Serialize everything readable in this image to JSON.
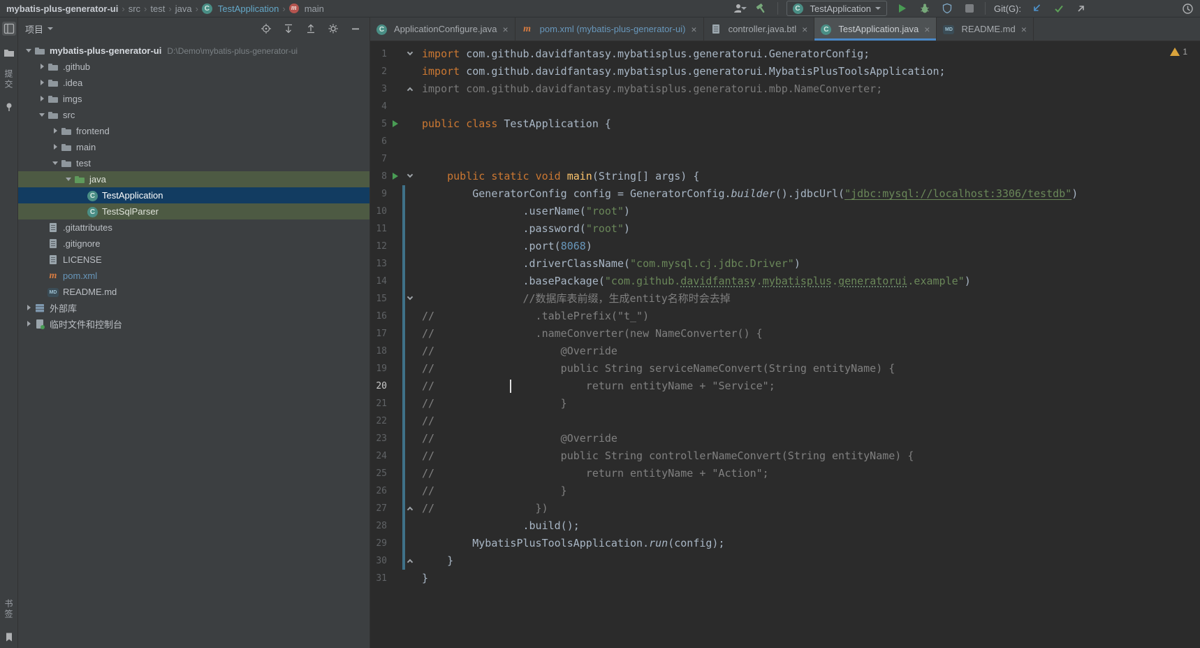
{
  "colors": {
    "accent_underline": "#4A88C7",
    "run_green": "#499C54",
    "selection_blue": "#123C61",
    "selection_green": "#4D5A43",
    "keyword_orange": "#CC7832",
    "string_green": "#6A8759",
    "number_blue": "#6897BB",
    "comment_gray": "#808080",
    "vcs_changed": "#3F7188"
  },
  "title_bar": {
    "breadcrumbs": [
      {
        "label": "mybatis-plus-generator-ui",
        "bold": true
      },
      {
        "label": "src"
      },
      {
        "label": "test"
      },
      {
        "label": "java"
      },
      {
        "label": "TestApplication",
        "icon": "class",
        "fg": "#64A8C8"
      },
      {
        "label": "main",
        "icon": "method"
      }
    ],
    "run_config": "TestApplication",
    "git_label": "Git(G):",
    "icons": [
      "user",
      "build",
      "run",
      "debug",
      "coverage",
      "stop",
      "update",
      "commit",
      "push",
      "history"
    ]
  },
  "left_toolbar": {
    "commit_label": "提交",
    "bookmarks_label": "书签"
  },
  "project_panel": {
    "title": "项目",
    "header_icons": [
      "locate",
      "expand-all",
      "collapse-all",
      "settings",
      "hide"
    ],
    "tree": [
      {
        "d": 0,
        "chev": "down",
        "icon": "root",
        "label": "mybatis-plus-generator-ui",
        "extra": "D:\\Demo\\mybatis-plus-generator-ui",
        "bold": true,
        "fg": "#D5D9DE"
      },
      {
        "d": 1,
        "chev": "right",
        "icon": "folder",
        "label": ".github"
      },
      {
        "d": 1,
        "chev": "right",
        "icon": "folder",
        "label": ".idea"
      },
      {
        "d": 1,
        "chev": "right",
        "icon": "folder",
        "label": "imgs"
      },
      {
        "d": 1,
        "chev": "down",
        "icon": "folder",
        "label": "src"
      },
      {
        "d": 2,
        "chev": "right",
        "icon": "folder",
        "label": "frontend"
      },
      {
        "d": 2,
        "chev": "right",
        "icon": "folder",
        "label": "main"
      },
      {
        "d": 2,
        "chev": "down",
        "icon": "folder",
        "label": "test"
      },
      {
        "d": 3,
        "chev": "down",
        "icon": "folder-test",
        "label": "java",
        "hl": "green",
        "fg": "#DFE3DA"
      },
      {
        "d": 4,
        "icon": "class",
        "label": "TestApplication",
        "hl": "blue",
        "fg": "#FFFFFF"
      },
      {
        "d": 4,
        "icon": "class",
        "label": "TestSqlParser",
        "hl": "green",
        "fg": "#DFE3DA"
      },
      {
        "d": 1,
        "icon": "file",
        "label": ".gitattributes"
      },
      {
        "d": 1,
        "icon": "file-gear",
        "label": ".gitignore"
      },
      {
        "d": 1,
        "icon": "file",
        "label": "LICENSE"
      },
      {
        "d": 1,
        "icon": "maven",
        "label": "pom.xml",
        "fg": "#6897BB"
      },
      {
        "d": 1,
        "icon": "markdown",
        "label": "README.md"
      },
      {
        "d": 0,
        "chev": "right",
        "icon": "library",
        "label": "外部库"
      },
      {
        "d": 0,
        "chev": "right",
        "icon": "scratch",
        "label": "临时文件和控制台"
      }
    ]
  },
  "editor": {
    "tabs": [
      {
        "label": "ApplicationConfigure.java",
        "icon": "class"
      },
      {
        "label": "pom.xml (mybatis-plus-generator-ui)",
        "icon": "maven",
        "fg": "#6897BB"
      },
      {
        "label": "controller.java.btl",
        "icon": "file"
      },
      {
        "label": "TestApplication.java",
        "icon": "class",
        "active": true
      },
      {
        "label": "README.md",
        "icon": "markdown"
      }
    ],
    "warnings": "1",
    "caret": {
      "line": 20,
      "col": 14
    },
    "code": {
      "current_line": 20,
      "run_lines": [
        5,
        8
      ],
      "changed_lines": [
        9,
        30
      ],
      "folds": {
        "1": "down",
        "3": "up",
        "8": "down",
        "15": "down",
        "27": "up",
        "30": "up"
      },
      "lines": [
        {
          "n": 1,
          "t": [
            [
              "k",
              "import"
            ],
            [
              "p",
              " com.github.davidfantasy.mybatisplus.generatorui.GeneratorConfig;"
            ]
          ]
        },
        {
          "n": 2,
          "t": [
            [
              "k",
              "import"
            ],
            [
              "p",
              " com.github.davidfantasy.mybatisplus.generatorui.MybatisPlusToolsApplication;"
            ]
          ]
        },
        {
          "n": 3,
          "t": [
            [
              "g",
              "import com.github.davidfantasy.mybatisplus.generatorui.mbp.NameConverter;"
            ]
          ]
        },
        {
          "n": 4,
          "t": []
        },
        {
          "n": 5,
          "t": [
            [
              "k",
              "public"
            ],
            [
              "p",
              " "
            ],
            [
              "k",
              "class"
            ],
            [
              "p",
              " TestApplication {"
            ]
          ]
        },
        {
          "n": 6,
          "t": []
        },
        {
          "n": 7,
          "t": []
        },
        {
          "n": 8,
          "t": [
            [
              "p",
              "    "
            ],
            [
              "k",
              "public"
            ],
            [
              "p",
              " "
            ],
            [
              "k",
              "static"
            ],
            [
              "p",
              " "
            ],
            [
              "k",
              "void"
            ],
            [
              "p",
              " "
            ],
            [
              "m",
              "main"
            ],
            [
              "p",
              "(String[] args) {"
            ]
          ]
        },
        {
          "n": 9,
          "t": [
            [
              "p",
              "        GeneratorConfig config = GeneratorConfig."
            ],
            [
              "i",
              "builder"
            ],
            [
              "p",
              "().jdbcUrl("
            ],
            [
              "su",
              "\"jdbc:mysql://localhost:3306/testdb\""
            ],
            [
              "p",
              ")"
            ]
          ]
        },
        {
          "n": 10,
          "t": [
            [
              "p",
              "                .userName("
            ],
            [
              "s",
              "\"root\""
            ],
            [
              "p",
              ")"
            ]
          ]
        },
        {
          "n": 11,
          "t": [
            [
              "p",
              "                .password("
            ],
            [
              "s",
              "\"root\""
            ],
            [
              "p",
              ")"
            ]
          ]
        },
        {
          "n": 12,
          "t": [
            [
              "p",
              "                .port("
            ],
            [
              "n",
              "8068"
            ],
            [
              "p",
              ")"
            ]
          ]
        },
        {
          "n": 13,
          "t": [
            [
              "p",
              "                .driverClassName("
            ],
            [
              "s",
              "\"com.mysql.cj.jdbc.Driver\""
            ],
            [
              "p",
              ")"
            ]
          ]
        },
        {
          "n": 14,
          "t": [
            [
              "p",
              "                .basePackage("
            ],
            [
              "s",
              "\"com.github."
            ],
            [
              "sw",
              "davidfantasy"
            ],
            [
              "s",
              "."
            ],
            [
              "sw",
              "mybatisplus"
            ],
            [
              "s",
              "."
            ],
            [
              "sw",
              "generatorui"
            ],
            [
              "s",
              ".example\""
            ],
            [
              "p",
              ")"
            ]
          ]
        },
        {
          "n": 15,
          "t": [
            [
              "c",
              "                //数据库表前缀，生成entity名称时会去掉"
            ]
          ]
        },
        {
          "n": 16,
          "t": [
            [
              "c",
              "//                .tablePrefix(\"t_\")"
            ]
          ]
        },
        {
          "n": 17,
          "t": [
            [
              "c",
              "//                .nameConverter(new NameConverter() {"
            ]
          ]
        },
        {
          "n": 18,
          "t": [
            [
              "c",
              "//                    @Override"
            ]
          ]
        },
        {
          "n": 19,
          "t": [
            [
              "c",
              "//                    public String serviceNameConvert(String entityName) {"
            ]
          ]
        },
        {
          "n": 20,
          "t": [
            [
              "c",
              "//                        return entityName + \"Service\";"
            ]
          ]
        },
        {
          "n": 21,
          "t": [
            [
              "c",
              "//                    }"
            ]
          ]
        },
        {
          "n": 22,
          "t": [
            [
              "c",
              "//"
            ]
          ]
        },
        {
          "n": 23,
          "t": [
            [
              "c",
              "//                    @Override"
            ]
          ]
        },
        {
          "n": 24,
          "t": [
            [
              "c",
              "//                    public String controllerNameConvert(String entityName) {"
            ]
          ]
        },
        {
          "n": 25,
          "t": [
            [
              "c",
              "//                        return entityName + \"Action\";"
            ]
          ]
        },
        {
          "n": 26,
          "t": [
            [
              "c",
              "//                    }"
            ]
          ]
        },
        {
          "n": 27,
          "t": [
            [
              "c",
              "//                })"
            ]
          ]
        },
        {
          "n": 28,
          "t": [
            [
              "p",
              "                .build();"
            ]
          ]
        },
        {
          "n": 29,
          "t": [
            [
              "p",
              "        MybatisPlusToolsApplication."
            ],
            [
              "i",
              "run"
            ],
            [
              "p",
              "(config);"
            ]
          ]
        },
        {
          "n": 30,
          "t": [
            [
              "p",
              "    }"
            ]
          ]
        },
        {
          "n": 31,
          "t": [
            [
              "p",
              "}"
            ]
          ]
        }
      ]
    }
  }
}
